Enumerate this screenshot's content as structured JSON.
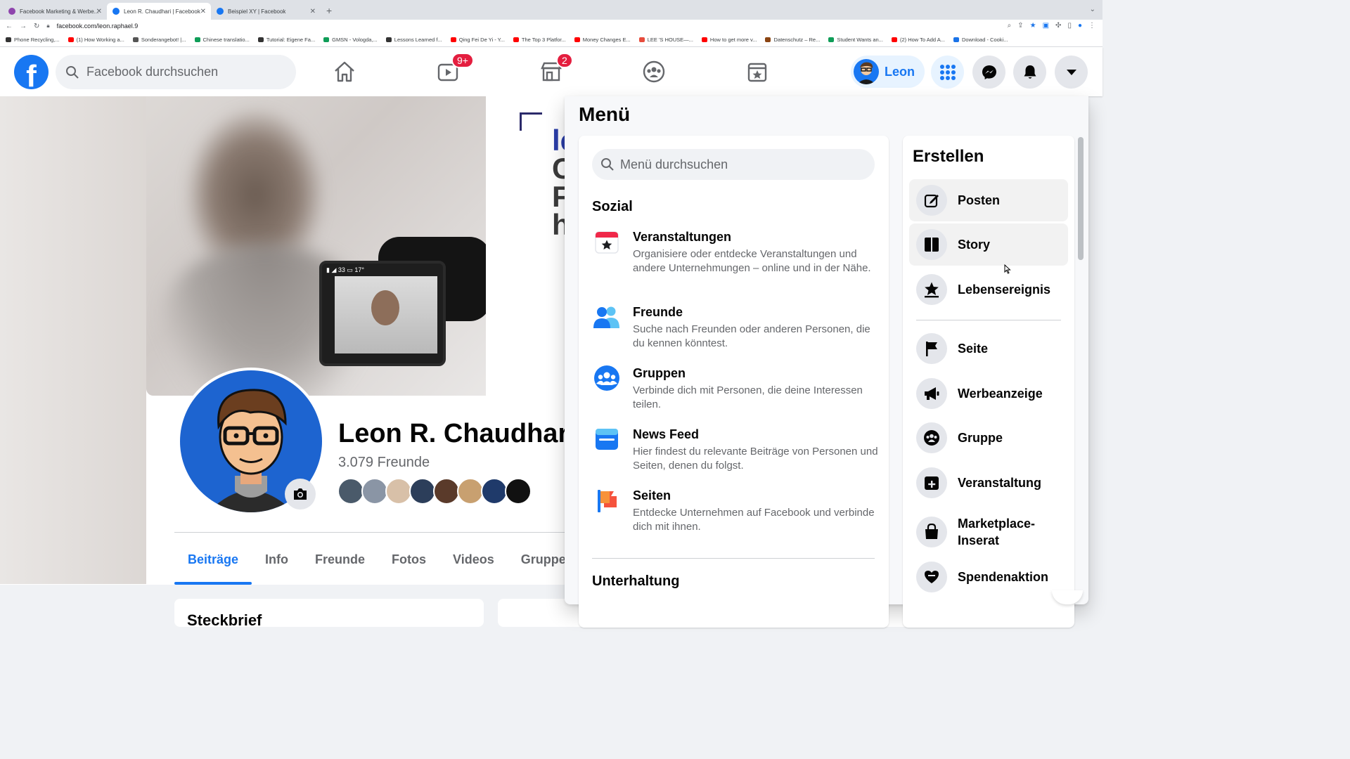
{
  "browser": {
    "tabs": [
      {
        "title": "Facebook Marketing & Werbe...",
        "color": "#8e44ad"
      },
      {
        "title": "Leon R. Chaudhari | Facebook",
        "color": "#1877f2"
      },
      {
        "title": "Beispiel XY | Facebook",
        "color": "#1877f2"
      }
    ],
    "new_tab": "+",
    "url": "facebook.com/leon.raphael.9",
    "bookmarks": [
      {
        "label": "Phone Recycling,...",
        "color": "#333333"
      },
      {
        "label": "(1) How Working a...",
        "color": "#ff0000"
      },
      {
        "label": "Sonderangebot! |...",
        "color": "#555555"
      },
      {
        "label": "Chinese translatio...",
        "color": "#0f9d58"
      },
      {
        "label": "Tutorial: Eigene Fa...",
        "color": "#333333"
      },
      {
        "label": "GMSN - Vologda,...",
        "color": "#0f9d58"
      },
      {
        "label": "Lessons Learned f...",
        "color": "#333333"
      },
      {
        "label": "Qing Fei De Yi - Y...",
        "color": "#ff0000"
      },
      {
        "label": "The Top 3 Platfor...",
        "color": "#ff0000"
      },
      {
        "label": "Money Changes E...",
        "color": "#ff0000"
      },
      {
        "label": "LEE 'S HOUSE—...",
        "color": "#e74c3c"
      },
      {
        "label": "How to get more v...",
        "color": "#ff0000"
      },
      {
        "label": "Datenschutz – Re...",
        "color": "#8b4513"
      },
      {
        "label": "Student Wants an...",
        "color": "#0f9d58"
      },
      {
        "label": "(2) How To Add A...",
        "color": "#ff0000"
      },
      {
        "label": "Download - Cooki...",
        "color": "#1a73e8"
      }
    ]
  },
  "header": {
    "search_placeholder": "Facebook durchsuchen",
    "watch_badge": "9+",
    "marketplace_badge": "2",
    "profile_name": "Leon"
  },
  "profile": {
    "name": "Leon R. Chaudhari",
    "friends": "3.079 Freunde",
    "cover_letters": [
      "le",
      "C",
      "F",
      "h"
    ],
    "tabs": [
      "Beiträge",
      "Info",
      "Freunde",
      "Fotos",
      "Videos",
      "Gruppen"
    ],
    "card_title": "Steckbrief"
  },
  "menu": {
    "title": "Menü",
    "search_placeholder": "Menü durchsuchen",
    "section_social": "Sozial",
    "items": [
      {
        "title": "Veranstaltungen",
        "desc": "Organisiere oder entdecke Veranstaltungen und andere Unternehmungen – online und in der Nähe."
      },
      {
        "title": "Freunde",
        "desc": "Suche nach Freunden oder anderen Personen, die du kennen könntest."
      },
      {
        "title": "Gruppen",
        "desc": "Verbinde dich mit Personen, die deine Interessen teilen."
      },
      {
        "title": "News Feed",
        "desc": "Hier findest du relevante Beiträge von Personen und Seiten, denen du folgst."
      },
      {
        "title": "Seiten",
        "desc": "Entdecke Unternehmen auf Facebook und verbinde dich mit ihnen."
      }
    ],
    "section_entertainment": "Unterhaltung",
    "create_title": "Erstellen",
    "create_items": [
      "Posten",
      "Story",
      "Lebensereignis",
      "Seite",
      "Werbeanzeige",
      "Gruppe",
      "Veranstaltung",
      "Marketplace-Inserat",
      "Spendenaktion"
    ]
  },
  "colors": {
    "brand": "#1877f2",
    "badge": "#e41e3f"
  }
}
